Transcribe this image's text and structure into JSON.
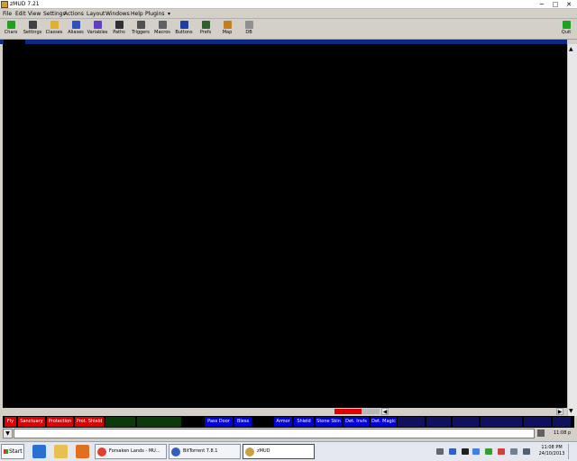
{
  "window": {
    "title": "zMUD 7.21",
    "controls": {
      "minimize": "─",
      "maximize": "□",
      "close": "✕"
    }
  },
  "menu": [
    {
      "label": "File",
      "name": "file"
    },
    {
      "label": "Edit",
      "name": "edit"
    },
    {
      "label": "View",
      "name": "view"
    },
    {
      "label": "Settings",
      "name": "settings"
    },
    {
      "label": "Actions",
      "name": "actions"
    },
    {
      "label": "Layout",
      "name": "layout"
    },
    {
      "label": "Windows",
      "name": "windows"
    },
    {
      "label": "Help",
      "name": "help"
    },
    {
      "label": "Plugins",
      "name": "plugins"
    },
    {
      "label": "▾",
      "name": "overflow"
    }
  ],
  "toolbar": [
    {
      "label": "Chars",
      "icon": "chars-icon",
      "color": "#20a020"
    },
    {
      "label": "Settings",
      "icon": "settings-icon",
      "color": "#404040"
    },
    {
      "label": "Classes",
      "icon": "folder-icon",
      "color": "#e0b030"
    },
    {
      "label": "Aliases",
      "icon": "aliases-icon",
      "color": "#3050c0"
    },
    {
      "label": "Variables",
      "icon": "variables-icon",
      "color": "#6040c0"
    },
    {
      "label": "Paths",
      "icon": "paths-icon",
      "color": "#303030"
    },
    {
      "label": "Triggers",
      "icon": "triggers-icon",
      "color": "#505050"
    },
    {
      "label": "Macros",
      "icon": "macros-icon",
      "color": "#606060"
    },
    {
      "label": "Buttons",
      "icon": "buttons-icon",
      "color": "#2040a0"
    },
    {
      "label": "Prefs",
      "icon": "prefs-icon",
      "color": "#306030"
    },
    {
      "label": "Map",
      "icon": "map-icon",
      "color": "#c08020"
    },
    {
      "label": "DB",
      "icon": "db-icon",
      "color": "#909090"
    }
  ],
  "quit": {
    "label": "Quit",
    "icon": "quit-icon",
    "color": "#20a020"
  },
  "status_buttons": [
    {
      "label": "Fly",
      "color": "#e00000"
    },
    {
      "label": "Sanctuary",
      "color": "#e00000"
    },
    {
      "label": "Protection",
      "color": "#e00000"
    },
    {
      "label": "Prot. Shield",
      "color": "#e00000"
    },
    {
      "label": "",
      "color": "#0a3a0a"
    },
    {
      "label": "",
      "color": "#0a3a0a"
    },
    {
      "label": "",
      "color": "#000000"
    },
    {
      "label": "Pass Door",
      "color": "#0000e0"
    },
    {
      "label": "Bless",
      "color": "#0000e0"
    },
    {
      "label": "",
      "color": "#000000"
    },
    {
      "label": "Armor",
      "color": "#0000e0"
    },
    {
      "label": "Shield",
      "color": "#0000e0"
    },
    {
      "label": "Stone Skin",
      "color": "#0000e0"
    },
    {
      "label": "Det. Invis",
      "color": "#0000e0"
    },
    {
      "label": "Det. Magic",
      "color": "#0000e0"
    },
    {
      "label": "",
      "color": "#101060"
    },
    {
      "label": "",
      "color": "#101060"
    },
    {
      "label": "",
      "color": "#101060"
    },
    {
      "label": "",
      "color": "#101060"
    },
    {
      "label": "",
      "color": "#101060"
    },
    {
      "label": "",
      "color": "#101060"
    }
  ],
  "command_input": {
    "value": "",
    "placeholder": ""
  },
  "input_clock": "11:08 p",
  "taskbar": {
    "start_label": "Start",
    "tasks": [
      {
        "label": "Forsaken Lands - MU...",
        "icon": "chrome-icon",
        "color": "#e04030"
      },
      {
        "label": "BitTorrent 7.8.1",
        "icon": "bittorrent-icon",
        "color": "#3060c0"
      },
      {
        "label": "zMUD",
        "icon": "zmud-icon",
        "color": "#c8a040"
      }
    ],
    "clock_time": "11:08 PM",
    "clock_date": "24/10/2013"
  }
}
